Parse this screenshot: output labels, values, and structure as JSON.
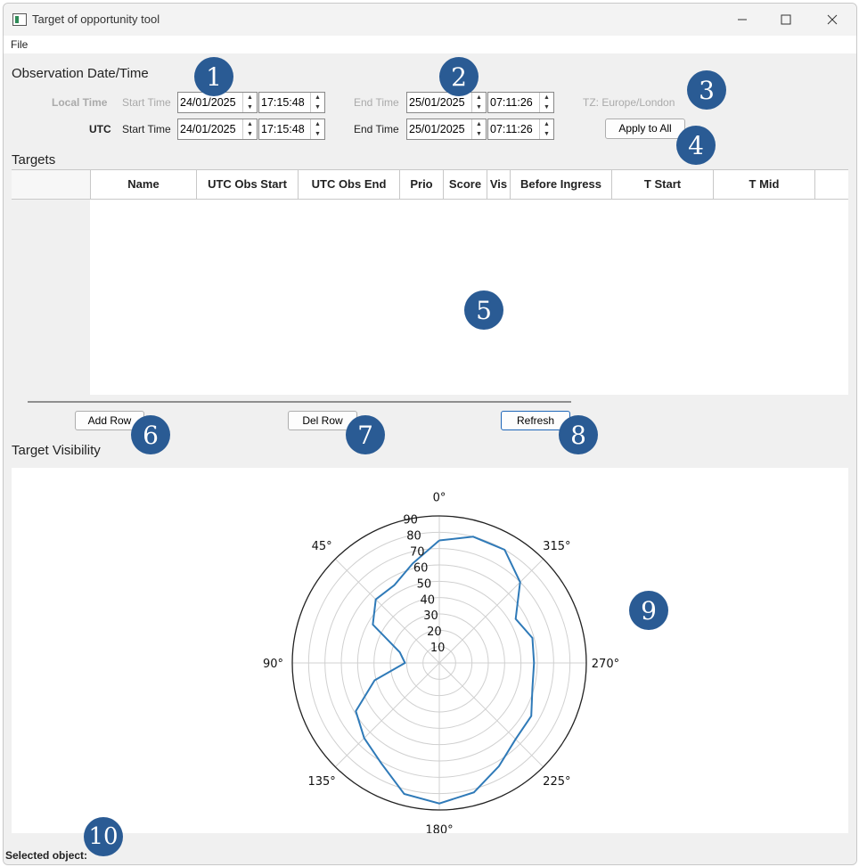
{
  "window": {
    "title": "Target of opportunity tool"
  },
  "menu": {
    "file": "File"
  },
  "observation": {
    "section_title": "Observation Date/Time",
    "local_time_label": "Local Time",
    "utc_label": "UTC",
    "start_time_label": "Start Time",
    "end_time_label": "End Time",
    "local_start_date": "24/01/2025",
    "local_start_time": "17:15:48",
    "local_end_date": "25/01/2025",
    "local_end_time": "07:11:26",
    "utc_start_date": "24/01/2025",
    "utc_start_time": "17:15:48",
    "utc_end_date": "25/01/2025",
    "utc_end_time": "07:11:26",
    "timezone": "TZ: Europe/London",
    "apply_button": "Apply to All"
  },
  "targets": {
    "section_title": "Targets",
    "columns": [
      "Name",
      "UTC Obs Start",
      "UTC Obs End",
      "Prio",
      "Score",
      "Vis",
      "Before Ingress",
      "T Start",
      "T Mid"
    ],
    "rows": []
  },
  "buttons": {
    "add_row": "Add Row",
    "del_row": "Del Row",
    "refresh": "Refresh"
  },
  "visibility": {
    "section_title": "Target Visibility"
  },
  "status": {
    "selected_object": "Selected object:"
  },
  "callouts": [
    "1",
    "2",
    "3",
    "4",
    "5",
    "6",
    "7",
    "8",
    "9",
    "10"
  ],
  "colors": {
    "badge": "#2a5b94",
    "series_line": "#2f7ab8"
  },
  "chart_data": {
    "type": "polar-line",
    "theta_direction": "counterclockwise",
    "theta_zero": "top",
    "angle_labels": [
      "0°",
      "45°",
      "90°",
      "135°",
      "180°",
      "225°",
      "270°",
      "315°"
    ],
    "radial_ticks": [
      10,
      20,
      30,
      40,
      50,
      60,
      70,
      80,
      90
    ],
    "radial_range": [
      0,
      90
    ],
    "series": [
      {
        "points": [
          {
            "theta": 0,
            "r": 75
          },
          {
            "theta": 15,
            "r": 63
          },
          {
            "theta": 30,
            "r": 55
          },
          {
            "theta": 45,
            "r": 55
          },
          {
            "theta": 60,
            "r": 47
          },
          {
            "theta": 75,
            "r": 25
          },
          {
            "theta": 90,
            "r": 21
          },
          {
            "theta": 105,
            "r": 41
          },
          {
            "theta": 120,
            "r": 59
          },
          {
            "theta": 135,
            "r": 65
          },
          {
            "theta": 150,
            "r": 71
          },
          {
            "theta": 165,
            "r": 83
          },
          {
            "theta": 180,
            "r": 86
          },
          {
            "theta": 195,
            "r": 82
          },
          {
            "theta": 210,
            "r": 73
          },
          {
            "theta": 225,
            "r": 66
          },
          {
            "theta": 240,
            "r": 65
          },
          {
            "theta": 255,
            "r": 59
          },
          {
            "theta": 270,
            "r": 58
          },
          {
            "theta": 285,
            "r": 59
          },
          {
            "theta": 300,
            "r": 54
          },
          {
            "theta": 315,
            "r": 70
          },
          {
            "theta": 330,
            "r": 80
          },
          {
            "theta": 345,
            "r": 80
          },
          {
            "theta": 360,
            "r": 75
          }
        ]
      }
    ]
  }
}
